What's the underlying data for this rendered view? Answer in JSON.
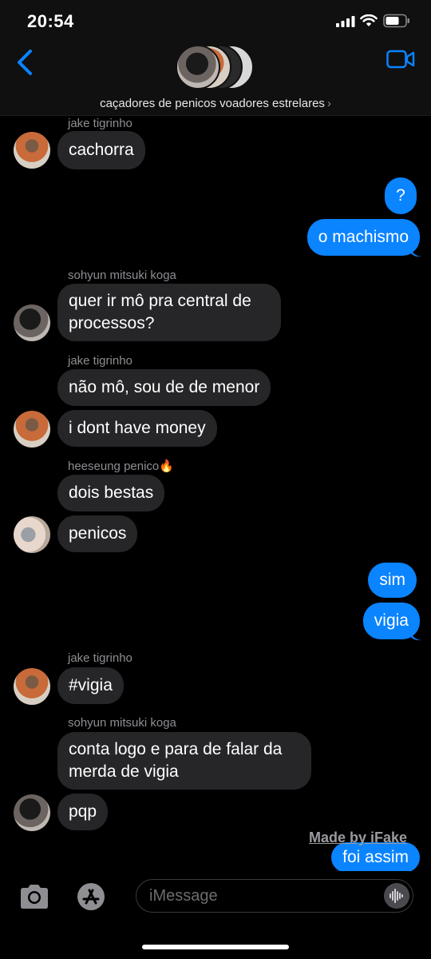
{
  "status_bar": {
    "time": "20:54"
  },
  "header": {
    "group_name": "caçadores de penicos voadores estrelares",
    "chevron": "›"
  },
  "messages": {
    "m1_sender": "jake tigrinho",
    "m1": "cachorra",
    "m2": "?",
    "m3": "o machismo",
    "m4_sender": "sohyun mitsuki koga",
    "m4": "quer ir mô pra central de processos?",
    "m5_sender": "jake tigrinho",
    "m5": "não mô, sou de de menor",
    "m6": "i dont have money",
    "m7_sender": "heeseung penico🔥",
    "m7": "dois bestas",
    "m8": "penicos",
    "m9": "sim",
    "m10": "vigia",
    "m11_sender": "jake tigrinho",
    "m11": "#vigia",
    "m12_sender": "sohyun mitsuki koga",
    "m12": "conta logo e para de falar da merda de vigia",
    "m13": "pqp",
    "m14": "foi assim"
  },
  "watermark": "Made by iFake",
  "input": {
    "placeholder": "iMessage"
  },
  "icons": [
    "back-chevron-icon",
    "video-camera-icon",
    "camera-icon",
    "app-store-icon",
    "audio-waveform-icon",
    "cellular-signal-icon",
    "wifi-icon",
    "battery-icon"
  ],
  "colors": {
    "outgoing_bubble": "#0a84ff",
    "incoming_bubble": "#262629",
    "accent": "#0a84ff"
  }
}
